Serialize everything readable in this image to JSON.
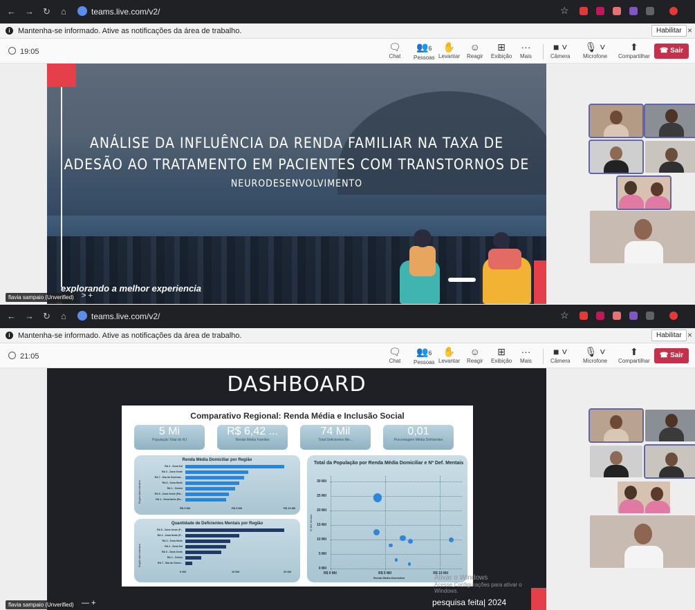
{
  "screenshots": [
    {
      "browser": {
        "url": "teams.live.com/v2/"
      },
      "infobar": {
        "message": "Mantenha-se informado. Ative as notificações da área de trabalho.",
        "enable_label": "Habilitar",
        "close_label": "×"
      },
      "meeting": {
        "timer": "19:05",
        "toolbar": {
          "chat": "Chat",
          "people": "Pessoas",
          "people_count": "6",
          "raise": "Levantar",
          "react": "Reagir",
          "view": "Exibição",
          "more": "Mais",
          "camera": "Câmera",
          "mic": "Microfone",
          "share": "Compartilhar",
          "leave": "Sair"
        },
        "slide": {
          "title_line1": "ANÁLISE DA INFLUÊNCIA DA RENDA FAMILIAR NA TAXA DE",
          "title_line2": "ADESÃO AO TRATAMENTO EM PACIENTES COM TRANSTORNOS DE",
          "title_line3": "NEURODESENVOLVIMENTO",
          "subtitle": "explorando a melhor experiencia"
        },
        "presenter_tag": "flavia sampaio (Unverified)",
        "tray": ">   +"
      }
    },
    {
      "browser": {
        "url": "teams.live.com/v2/"
      },
      "infobar": {
        "message": "Mantenha-se informado. Ative as notificações da área de trabalho.",
        "enable_label": "Habilitar",
        "close_label": "×"
      },
      "meeting": {
        "timer": "21:05",
        "toolbar": {
          "chat": "Chat",
          "people": "Pessoas",
          "people_count": "6",
          "raise": "Levantar",
          "react": "Reagir",
          "view": "Exibição",
          "more": "Mais",
          "camera": "Câmera",
          "mic": "Microfone",
          "share": "Compartilhar",
          "leave": "Sair"
        },
        "slide": {
          "title": "DASHBOARD",
          "panel_title": "Comparativo Regional: Renda Média e Inclusão Social",
          "kpis": [
            {
              "value": "5 Mi",
              "label": "População Total do RJ"
            },
            {
              "value": "R$ 6,42 ...",
              "label": "Renda Média Familiar"
            },
            {
              "value": "74 Mil",
              "label": "Total Deficientes Me..."
            },
            {
              "value": "0,01",
              "label": "Porcentagem Média Deficientes"
            }
          ],
          "footer": "pesquisa feita| 2024",
          "windows_watermark": {
            "line1": "Ativar o Windows",
            "line2": "Acesse Configurações para ativar o Windows."
          }
        },
        "presenter_tag": "flavia sampaio (Unverified)",
        "tray": "—   +"
      }
    }
  ],
  "chart_data": [
    {
      "type": "bar",
      "orientation": "horizontal",
      "title": "Renda Média Domiciliar por Região",
      "ylabel": "Região Administrativa",
      "categories": [
        "RA 2 - Zona Sul",
        "RA 3 - Zona Oeste",
        "RA 7 - Ilha do Governa...",
        "RA 5 - Zona Norte",
        "RA 1 - Centro",
        "RA 6 - Zona Oeste (Pal...",
        "RA 4 - Zona Norte (Pa..."
      ],
      "values": [
        11,
        7,
        6.5,
        6,
        5.5,
        4.8,
        4.5
      ],
      "xticks": [
        "R$ 0 Mil",
        "R$ 5 Mil",
        "R$ 10 Mil"
      ],
      "xlim": [
        0,
        11.5
      ],
      "color": "#1e88e5"
    },
    {
      "type": "bar",
      "orientation": "horizontal",
      "title": "Quantidade de Deficientes Mentais por Região",
      "ylabel": "Região Administrativa",
      "categories": [
        "RA 6 - Zona Oeste (P...",
        "RA 4 - Zona Norte (P...",
        "RA 3 - Zona Norte",
        "RA 2 - Zona Sul",
        "RA 3 - Zona Oeste",
        "RA 1 - Centro",
        "RA 7 - Ilha do Gover..."
      ],
      "values": [
        22,
        12,
        10,
        9,
        8,
        3.5,
        1.5
      ],
      "xticks": [
        "0 Mil",
        "10 Mil",
        "20 Mil"
      ],
      "xlim": [
        0,
        23
      ],
      "color": "#1f3a6a"
    },
    {
      "type": "scatter",
      "title": "Total da População por Renda Média Domiciliar e Nº Def. Mentais",
      "xlabel": "Renda Média Domiciliar",
      "ylabel": "Nº Def. Mentais",
      "xticks": [
        "R$ 0 Mil",
        "R$ 5 Mil",
        "R$ 10 Mil"
      ],
      "yticks": [
        "0 Mil",
        "5 Mil",
        "10 Mil",
        "15 Mil",
        "20 Mil",
        "25 Mil",
        "30 Mil"
      ],
      "xlim": [
        0,
        12
      ],
      "ylim": [
        0,
        32
      ],
      "points": [
        {
          "x": 4.3,
          "y": 24.5,
          "size": 3
        },
        {
          "x": 4.2,
          "y": 12.5,
          "size": 2
        },
        {
          "x": 6.6,
          "y": 10.5,
          "size": 1.8
        },
        {
          "x": 7.3,
          "y": 9.5,
          "size": 1.3
        },
        {
          "x": 11.0,
          "y": 10.0,
          "size": 1.3
        },
        {
          "x": 5.5,
          "y": 8.0,
          "size": 0.8
        },
        {
          "x": 6.0,
          "y": 3.0,
          "size": 0.6
        },
        {
          "x": 7.2,
          "y": 1.5,
          "size": 0.6
        }
      ],
      "color": "#2f86d6"
    }
  ]
}
